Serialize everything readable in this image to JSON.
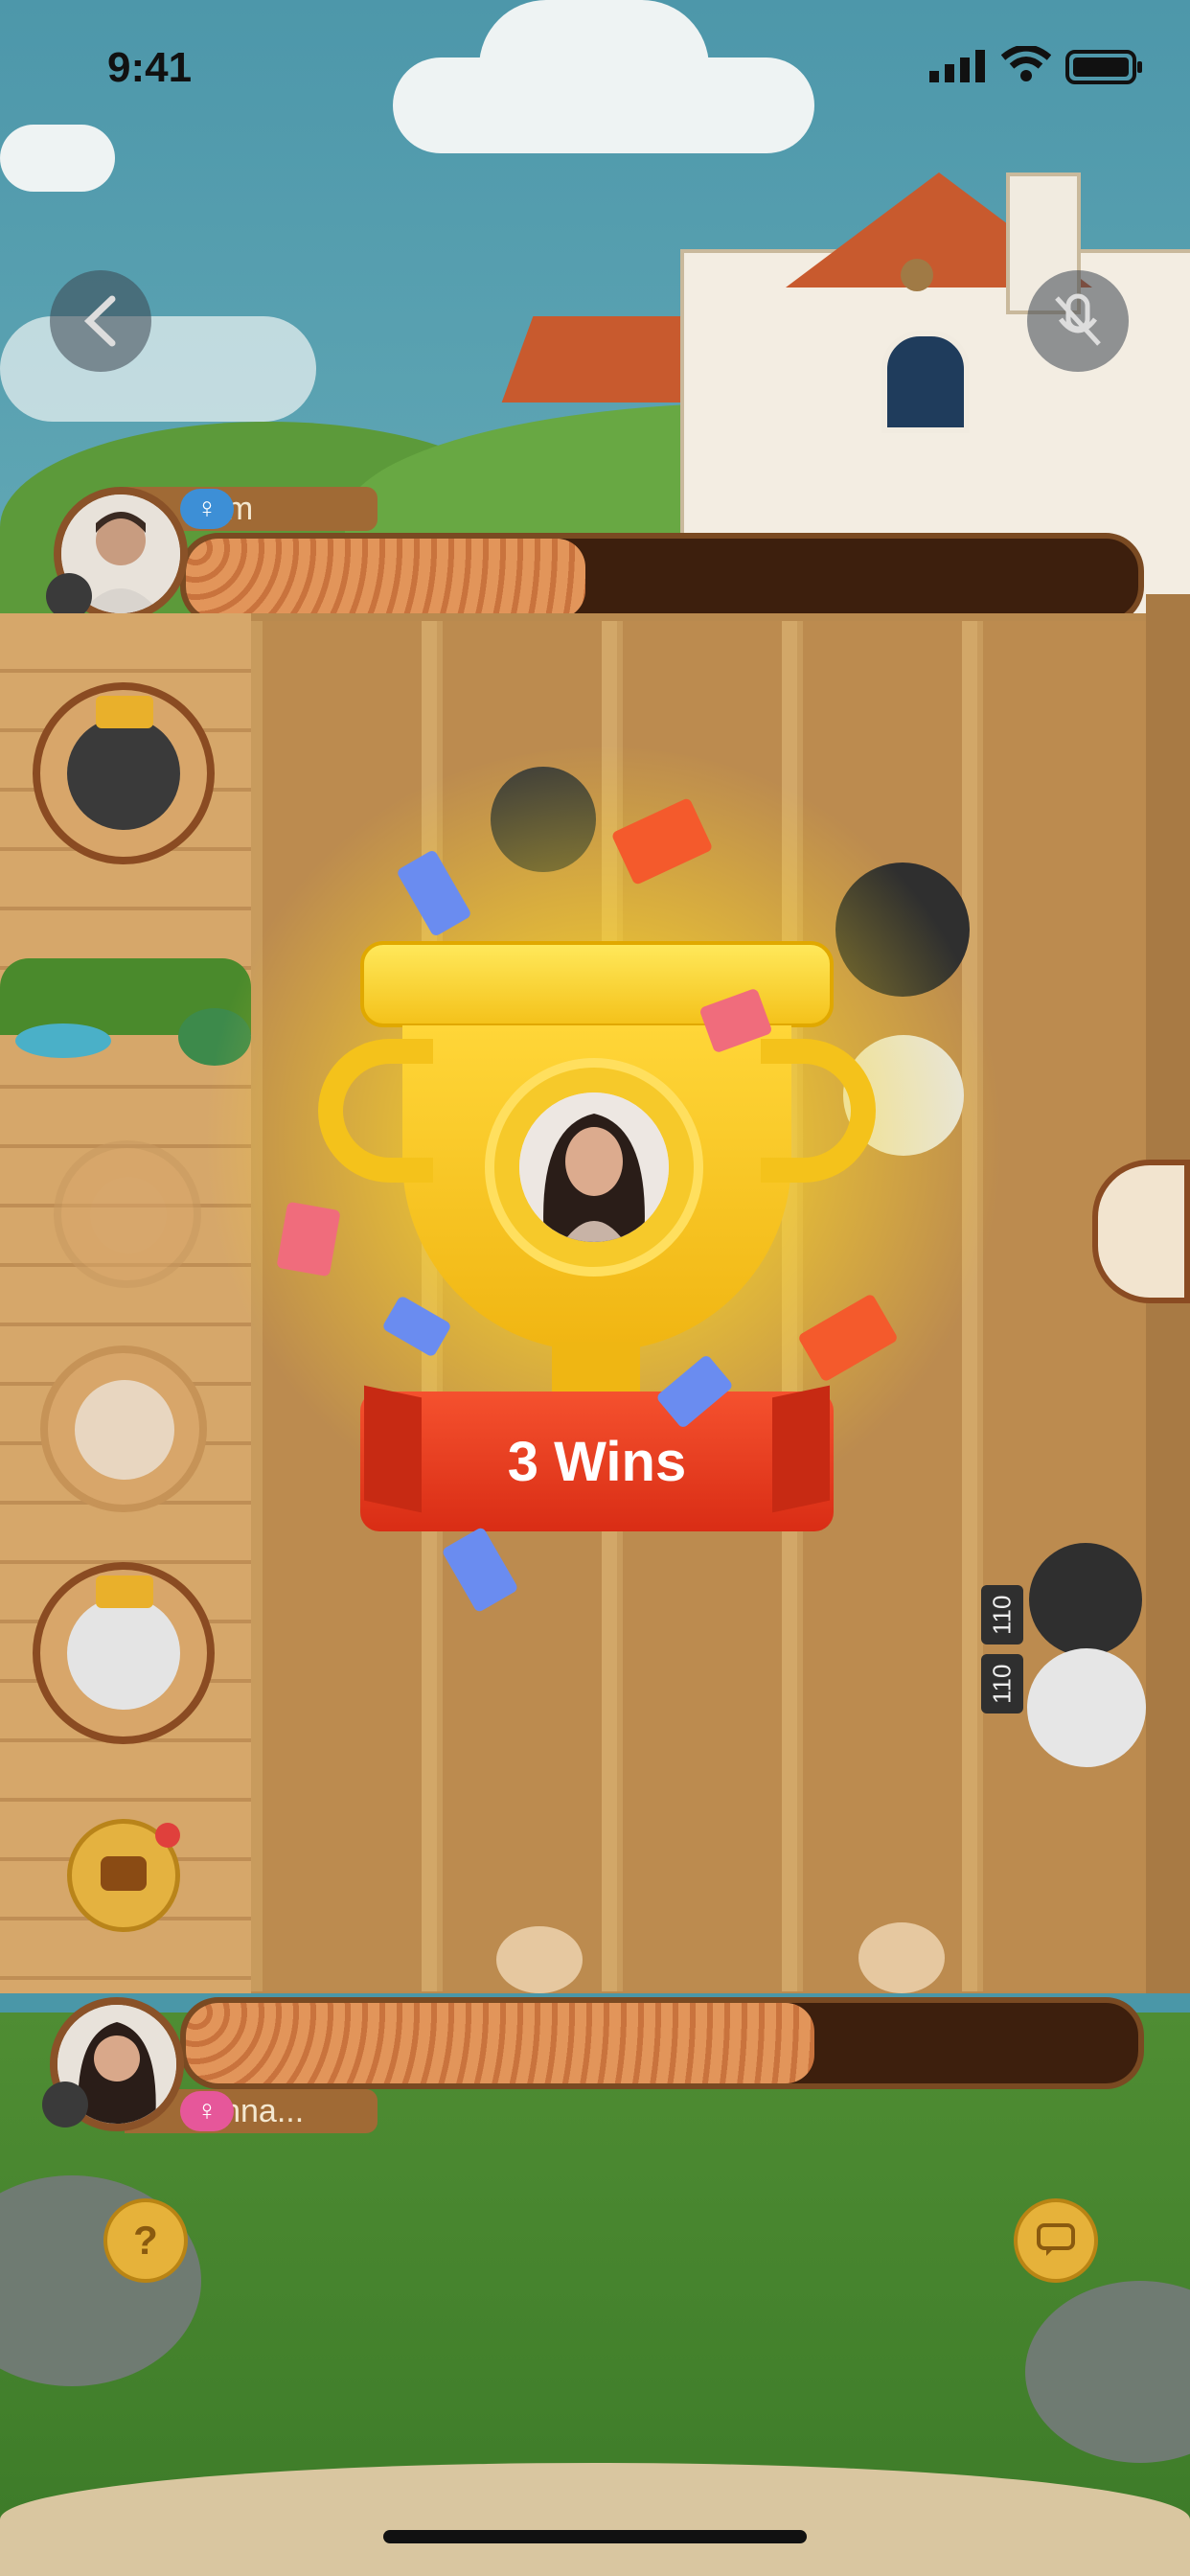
{
  "status_bar": {
    "time": "9:41"
  },
  "top_player": {
    "name": "Tom",
    "gender_symbol": "♀",
    "progress_fraction": 0.42
  },
  "bottom_player": {
    "name": "slinna...",
    "gender_symbol": "♀",
    "progress_fraction": 0.66
  },
  "win_popup": {
    "label": "3 Wins"
  },
  "score_tags": [
    "110",
    "110"
  ],
  "help_label": "?",
  "colors": {
    "tom_gender": "#3d8fd6",
    "slinna_gender": "#e6579a",
    "banner": "#e8341f",
    "trophy": "#f5c41f"
  },
  "icons": [
    "back-arrow-icon",
    "mic-off-icon",
    "question-icon",
    "chat-icon",
    "layers-icon"
  ]
}
